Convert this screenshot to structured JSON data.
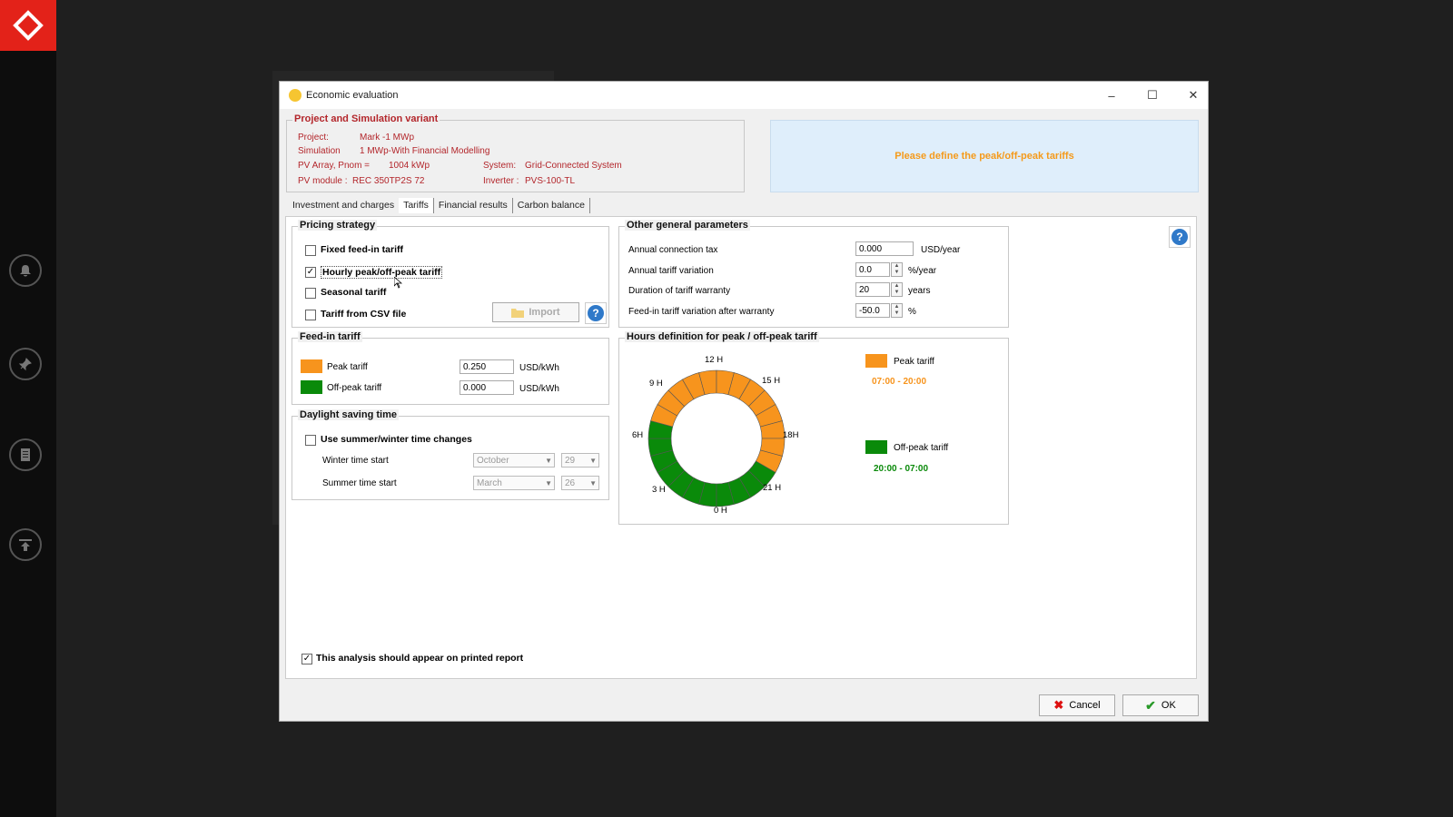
{
  "window": {
    "title": "Economic evaluation",
    "minimize": "–",
    "maximize": "☐",
    "close": "✕"
  },
  "project": {
    "group_title": "Project and Simulation variant",
    "project_label": "Project:",
    "project_value": "Mark -1 MWp",
    "simulation_label": "Simulation",
    "simulation_value": "1 MWp-With Financial Modelling",
    "pv_array_label": "PV Array, Pnom =",
    "pv_array_value": "1004 kWp",
    "system_label": "System:",
    "system_value": "Grid-Connected System",
    "pv_module_label": "PV module :",
    "pv_module_value": "REC 350TP2S 72",
    "inverter_label": "Inverter :",
    "inverter_value": "PVS-100-TL"
  },
  "info_message": "Please define the peak/off-peak tariffs",
  "tabs": [
    {
      "label": "Investment and charges"
    },
    {
      "label": "Tariffs"
    },
    {
      "label": "Financial results"
    },
    {
      "label": "Carbon balance"
    }
  ],
  "pricing": {
    "title": "Pricing strategy",
    "fixed": {
      "label": "Fixed feed-in tariff",
      "checked": ""
    },
    "hourly": {
      "label": "Hourly peak/off-peak tariff",
      "checked": "✓"
    },
    "seasonal": {
      "label": "Seasonal tariff",
      "checked": ""
    },
    "csv": {
      "label": "Tariff from CSV file",
      "checked": ""
    },
    "import_label": "Import"
  },
  "general": {
    "title": "Other general parameters",
    "connection_tax": {
      "label": "Annual connection tax",
      "value": "0.000",
      "unit": "USD/year"
    },
    "tariff_variation": {
      "label": "Annual tariff variation",
      "value": "0.0",
      "unit": "%/year"
    },
    "warranty": {
      "label": "Duration of tariff warranty",
      "value": "20",
      "unit": "years"
    },
    "after_warranty": {
      "label": "Feed-in tariff variation after warranty",
      "value": "-50.0",
      "unit": "%"
    }
  },
  "feedin": {
    "title": "Feed-in tariff",
    "peak": {
      "label": "Peak tariff",
      "value": "0.250",
      "unit": "USD/kWh",
      "color": "#f7941d"
    },
    "offpeak": {
      "label": "Off-peak tariff",
      "value": "0.000",
      "unit": "USD/kWh",
      "color": "#0a8a0a"
    }
  },
  "dst": {
    "title": "Daylight saving time",
    "use_label": "Use summer/winter time changes",
    "use_checked": "",
    "winter_label": "Winter time start",
    "winter_month": "October",
    "winter_day": "29",
    "summer_label": "Summer time start",
    "summer_month": "March",
    "summer_day": "26"
  },
  "hours": {
    "title": "Hours definition for peak / off-peak tariff",
    "labels": {
      "h12": "12 H",
      "h15": "15 H",
      "h18": "18H",
      "h21": "21 H",
      "h0": "0 H",
      "h3": "3 H",
      "h6": "6H",
      "h9": "9 H"
    },
    "peak_legend": "Peak tariff",
    "peak_range": "07:00 - 20:00",
    "offpeak_legend": "Off-peak tariff",
    "offpeak_range": "20:00 - 07:00",
    "peak_hours": [
      7,
      8,
      9,
      10,
      11,
      12,
      13,
      14,
      15,
      16,
      17,
      18,
      19
    ],
    "peak_color": "#f7941d",
    "offpeak_color": "#0a8a0a",
    "peak_range_color": "#f7941d",
    "offpeak_range_color": "#0a8a0a"
  },
  "report": {
    "label": "This analysis should appear on printed report",
    "checked": "✓"
  },
  "buttons": {
    "cancel": "Cancel",
    "ok": "OK"
  }
}
